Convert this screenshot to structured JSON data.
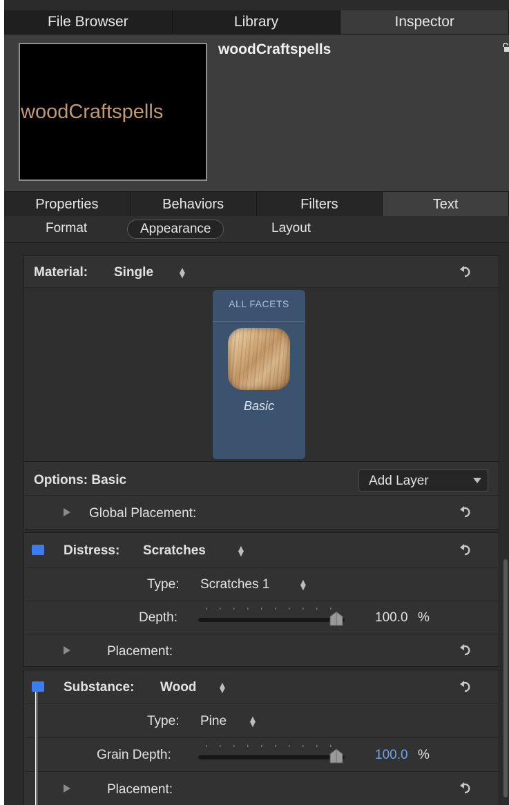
{
  "top_tabs": [
    "File Browser",
    "Library",
    "Inspector"
  ],
  "object": {
    "name": "woodCraftspells",
    "preview_text": "woodCraftspells"
  },
  "inspector_tabs": [
    "Properties",
    "Behaviors",
    "Filters",
    "Text"
  ],
  "sub_tabs": [
    "Format",
    "Appearance",
    "Layout"
  ],
  "material": {
    "label": "Material:",
    "value": "Single",
    "facet_header": "ALL FACETS",
    "facet_name": "Basic"
  },
  "options": {
    "label": "Options: Basic",
    "add_layer": "Add Layer",
    "global_placement": "Global Placement:"
  },
  "distress": {
    "label": "Distress:",
    "value": "Scratches",
    "type_label": "Type:",
    "type_value": "Scratches 1",
    "depth_label": "Depth:",
    "depth_value": "100.0",
    "depth_unit": "%",
    "placement": "Placement:"
  },
  "substance": {
    "label": "Substance:",
    "value": "Wood",
    "type_label": "Type:",
    "type_value": "Pine",
    "grain_label": "Grain Depth:",
    "grain_value": "100.0",
    "grain_unit": "%",
    "placement": "Placement:"
  },
  "colors": {
    "checkbox": "#3a7df3",
    "facet_card": "#3b536f",
    "preview_text": "#c19a6e",
    "highlight_value": "#6fa4e8"
  }
}
